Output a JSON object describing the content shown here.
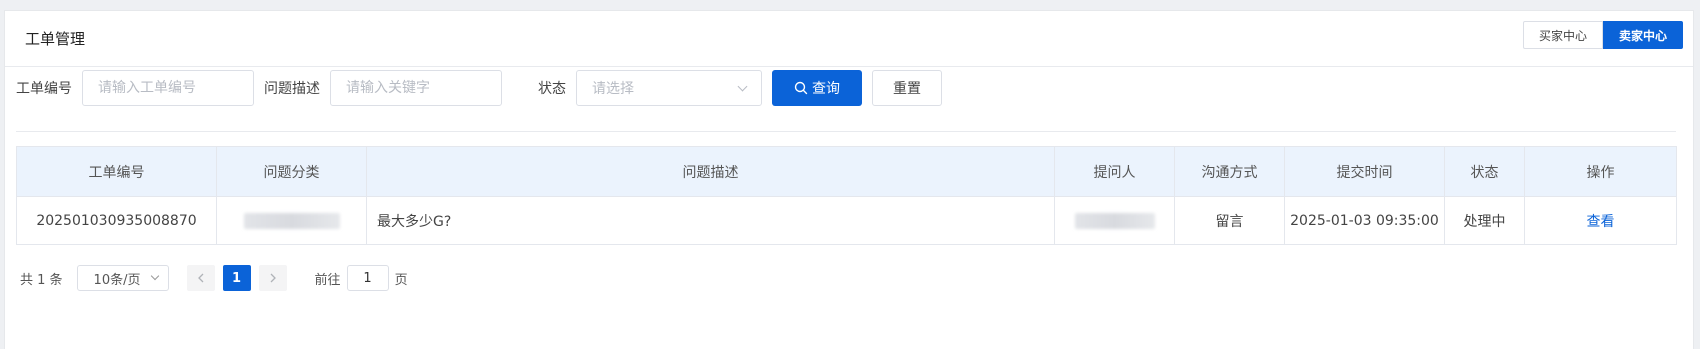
{
  "header": {
    "title": "工单管理",
    "role_switch": {
      "buyer": "买家中心",
      "seller": "卖家中心",
      "active": "seller"
    }
  },
  "search": {
    "ticket_no_label": "工单编号",
    "ticket_no_placeholder": "请输入工单编号",
    "desc_label": "问题描述",
    "desc_placeholder": "请输入关键字",
    "status_label": "状态",
    "status_placeholder": "请选择",
    "query_label": "查询",
    "reset_label": "重置"
  },
  "table": {
    "columns": [
      "工单编号",
      "问题分类",
      "问题描述",
      "提问人",
      "沟通方式",
      "提交时间",
      "状态",
      "操作"
    ],
    "rows": [
      {
        "ticket_no": "202501030935008870",
        "category": "",
        "description": "最大多少G?",
        "asker": "",
        "channel": "留言",
        "submitted_at": "2025-01-03 09:35:00",
        "status": "处理中",
        "action": "查看"
      }
    ]
  },
  "pagination": {
    "total_text": "共 1 条",
    "page_size": "10条/页",
    "current_page": "1",
    "goto_label": "前往",
    "goto_value": "1",
    "page_unit": "页"
  },
  "colors": {
    "primary": "#0b63d8",
    "header_bg": "#ebf3fd"
  }
}
